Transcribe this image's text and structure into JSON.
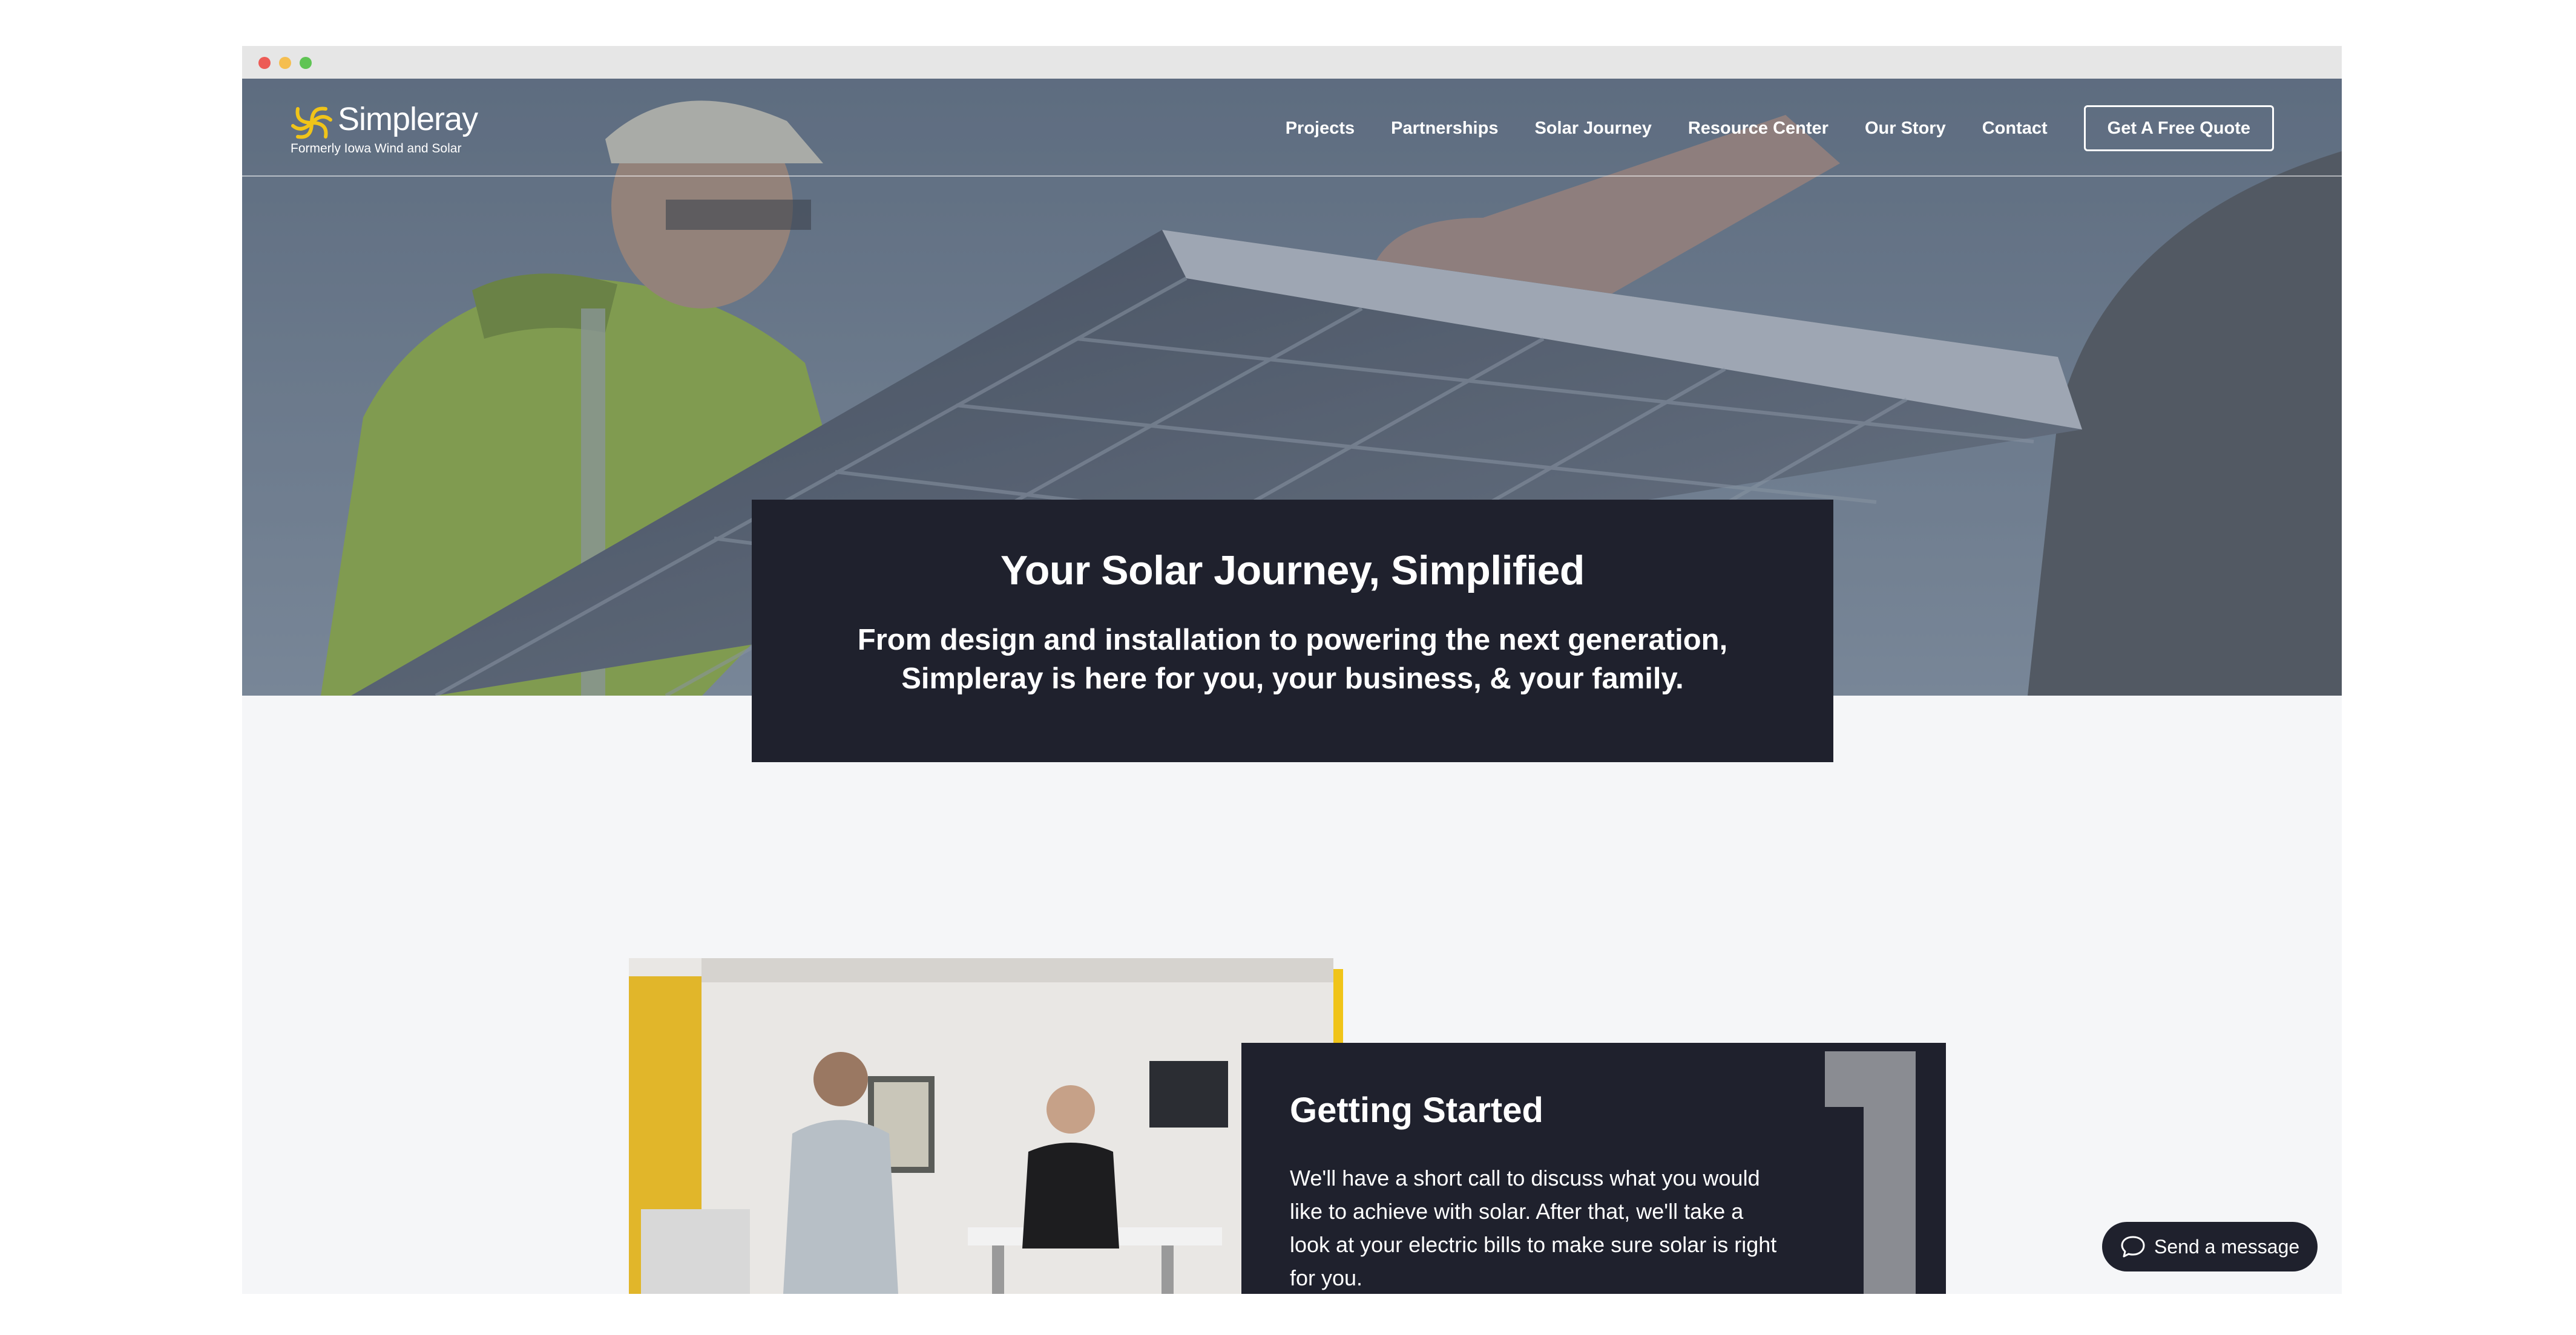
{
  "brand": {
    "name": "Simpleray",
    "tagline": "Formerly Iowa Wind and Solar",
    "accent_color": "#f0c419",
    "dark_color": "#1f212d"
  },
  "nav": {
    "items": [
      {
        "label": "Projects"
      },
      {
        "label": "Partnerships"
      },
      {
        "label": "Solar Journey"
      },
      {
        "label": "Resource Center"
      },
      {
        "label": "Our Story"
      },
      {
        "label": "Contact"
      }
    ],
    "cta_label": "Get A Free Quote"
  },
  "hero": {
    "title": "Your Solar Journey, Simplified",
    "subtitle": "From design and installation to powering the next generation, Simpleray is here for you, your business, & your family."
  },
  "step": {
    "title": "Getting Started",
    "text": "We'll have a short call to discuss what you would like to achieve with solar. After that, we'll take a look at your electric bills to make sure solar is right for you."
  },
  "chat": {
    "label": "Send a message",
    "icon": "chat-bubble-icon"
  }
}
